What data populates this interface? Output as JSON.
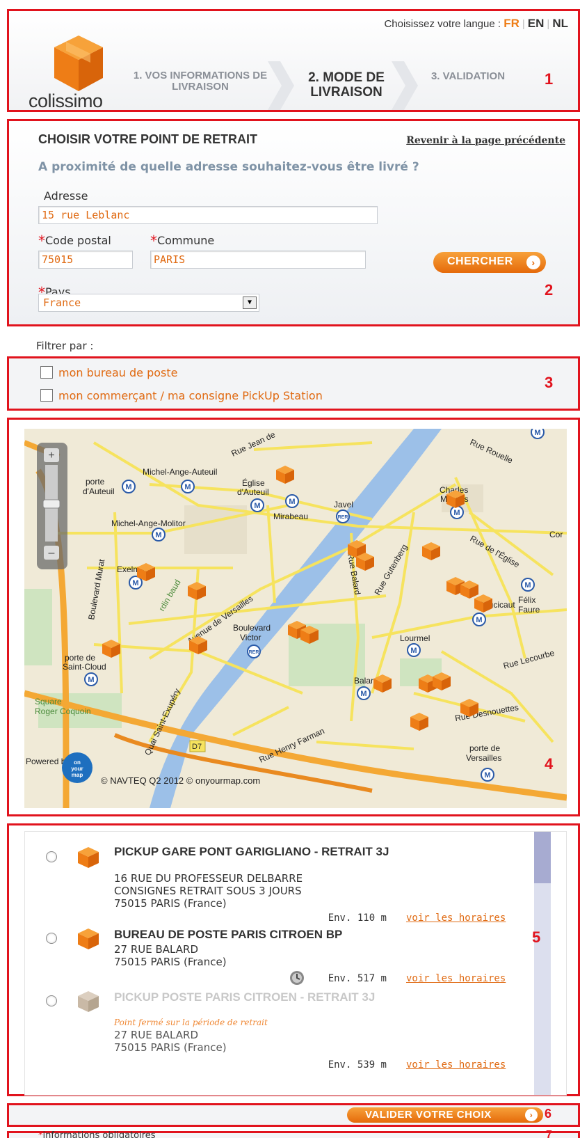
{
  "header": {
    "language_prompt": "Choisissez votre langue :",
    "languages": [
      "FR",
      "EN",
      "NL"
    ],
    "logo_text": "colissimo",
    "steps": [
      "1. VOS INFORMATIONS DE LIVRAISON",
      "2. MODE DE LIVRAISON",
      "3. VALIDATION"
    ],
    "section_number": "1"
  },
  "form": {
    "title": "CHOISIR VOTRE POINT DE RETRAIT",
    "back_link": "Revenir à la page précédente",
    "question": "A proximité de quelle adresse souhaitez-vous être livré ?",
    "address_label": "Adresse",
    "address_value": "15 rue Leblanc",
    "postal_label": "Code postal",
    "postal_value": "75015",
    "city_label": "Commune",
    "city_value": "PARIS",
    "country_label": "Pays",
    "country_value": "France",
    "search_button": "CHERCHER",
    "required_mark": "*",
    "section_number": "2"
  },
  "filters": {
    "label": "Filtrer par :",
    "options": [
      "mon bureau de poste",
      "mon commerçant / ma consigne PickUp Station"
    ],
    "section_number": "3"
  },
  "map": {
    "labels": [
      "Rue Jean de",
      "Rue Rouelle",
      "porte d'Auteuil",
      "Michel-Ange-Auteuil",
      "Église d'Auteuil",
      "Charles Michels",
      "Mirabeau",
      "Javel",
      "Michel-Ange-Molitor",
      "Exelmans",
      "Boulevard Murat",
      "Avenue de Versailles",
      "Rue Balard",
      "Rue Gutenberg",
      "Rue de l'Église",
      "Boucicaut",
      "Félix Faure",
      "Boulevard Victor",
      "Lourmel",
      "Rue Lecourbe",
      "porte de Saint-Cloud",
      "Balard",
      "Square Roger Coquoin",
      "Quai Saint-Exupéry",
      "Rue Henry Farman",
      "Rue Desnouettes",
      "porte de Versailles",
      "D7",
      "Cor"
    ],
    "powered_by": "Powered by",
    "copyright": "© NAVTEQ Q2 2012 © onyourmap.com",
    "section_number": "4"
  },
  "results": {
    "items": [
      {
        "name": "PICKUP GARE PONT GARIGLIANO - RETRAIT 3J",
        "address": [
          "16 RUE DU PROFESSEUR DELBARRE",
          "CONSIGNES RETRAIT SOUS 3 JOURS",
          "75015 PARIS (France)"
        ],
        "distance": "Env. 110 m",
        "hours_link": "voir les horaires"
      },
      {
        "name": "BUREAU DE POSTE PARIS CITROEN BP",
        "address": [
          "27 RUE BALARD",
          "75015 PARIS (France)"
        ],
        "distance": "Env. 517 m",
        "hours_link": "voir les horaires"
      },
      {
        "name": "PICKUP POSTE PARIS CITROEN - RETRAIT 3J",
        "note": "Point fermé sur la période de retrait",
        "address": [
          "27 RUE BALARD",
          "75015 PARIS (France)"
        ],
        "distance": "Env. 539 m",
        "hours_link": "voir les horaires"
      }
    ],
    "section_number": "5"
  },
  "footer": {
    "validate_button": "VALIDER VOTRE CHOIX",
    "section_number_6": "6",
    "required_note": "informations obligatoires",
    "section_number_7": "7"
  },
  "colors": {
    "accent": "#ee7d16",
    "annotation": "#e1131d",
    "water": "#9cc0e8"
  }
}
